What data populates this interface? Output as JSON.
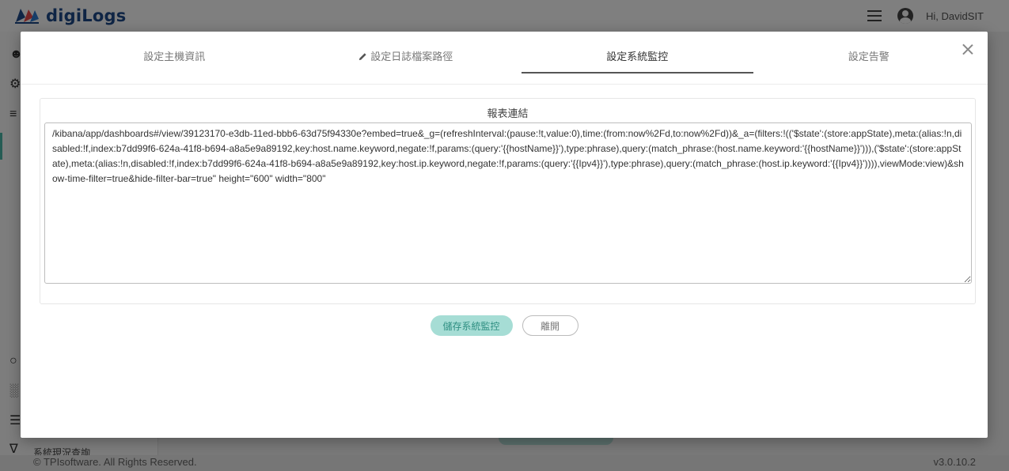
{
  "app": {
    "logo_text": "digiLogs",
    "greeting": "Hi, DavidSIT",
    "sidebar_partial_label": "系統現況查詢",
    "copyright": "© TPIsoftware. All Rights Reserved.",
    "version": "v3.0.10.2"
  },
  "modal": {
    "tabs": [
      {
        "label": "設定主機資訊",
        "active": false
      },
      {
        "label": "設定日誌檔案路徑",
        "active": false,
        "icon": "pencil-icon"
      },
      {
        "label": "設定系統監控",
        "active": true
      },
      {
        "label": "設定告警",
        "active": false
      }
    ],
    "section_title": "報表連結",
    "report_url": "/kibana/app/dashboards#/view/39123170-e3db-11ed-bbb6-63d75f94330e?embed=true&_g=(refreshInterval:(pause:!t,value:0),time:(from:now%2Fd,to:now%2Fd))&_a=(filters:!(('$state':(store:appState),meta:(alias:!n,disabled:!f,index:b7dd99f6-624a-41f8-b694-a8a5e9a89192,key:host.name.keyword,negate:!f,params:(query:'{{hostName}}'),type:phrase),query:(match_phrase:(host.name.keyword:'{{hostName}}'))),('$state':(store:appState),meta:(alias:!n,disabled:!f,index:b7dd99f6-624a-41f8-b694-a8a5e9a89192,key:host.ip.keyword,negate:!f,params:(query:'{{Ipv4}}'),type:phrase),query:(match_phrase:(host.ip.keyword:'{{Ipv4}}')))),viewMode:view)&show-time-filter=true&hide-filter-bar=true\" height=\"600\" width=\"800\"",
    "save_label": "儲存系統監控",
    "leave_label": "離開"
  },
  "colors": {
    "accent": "#4bb8a9",
    "save_button_bg": "#a6ddd5",
    "logo_blue": "#1f4a8a"
  }
}
